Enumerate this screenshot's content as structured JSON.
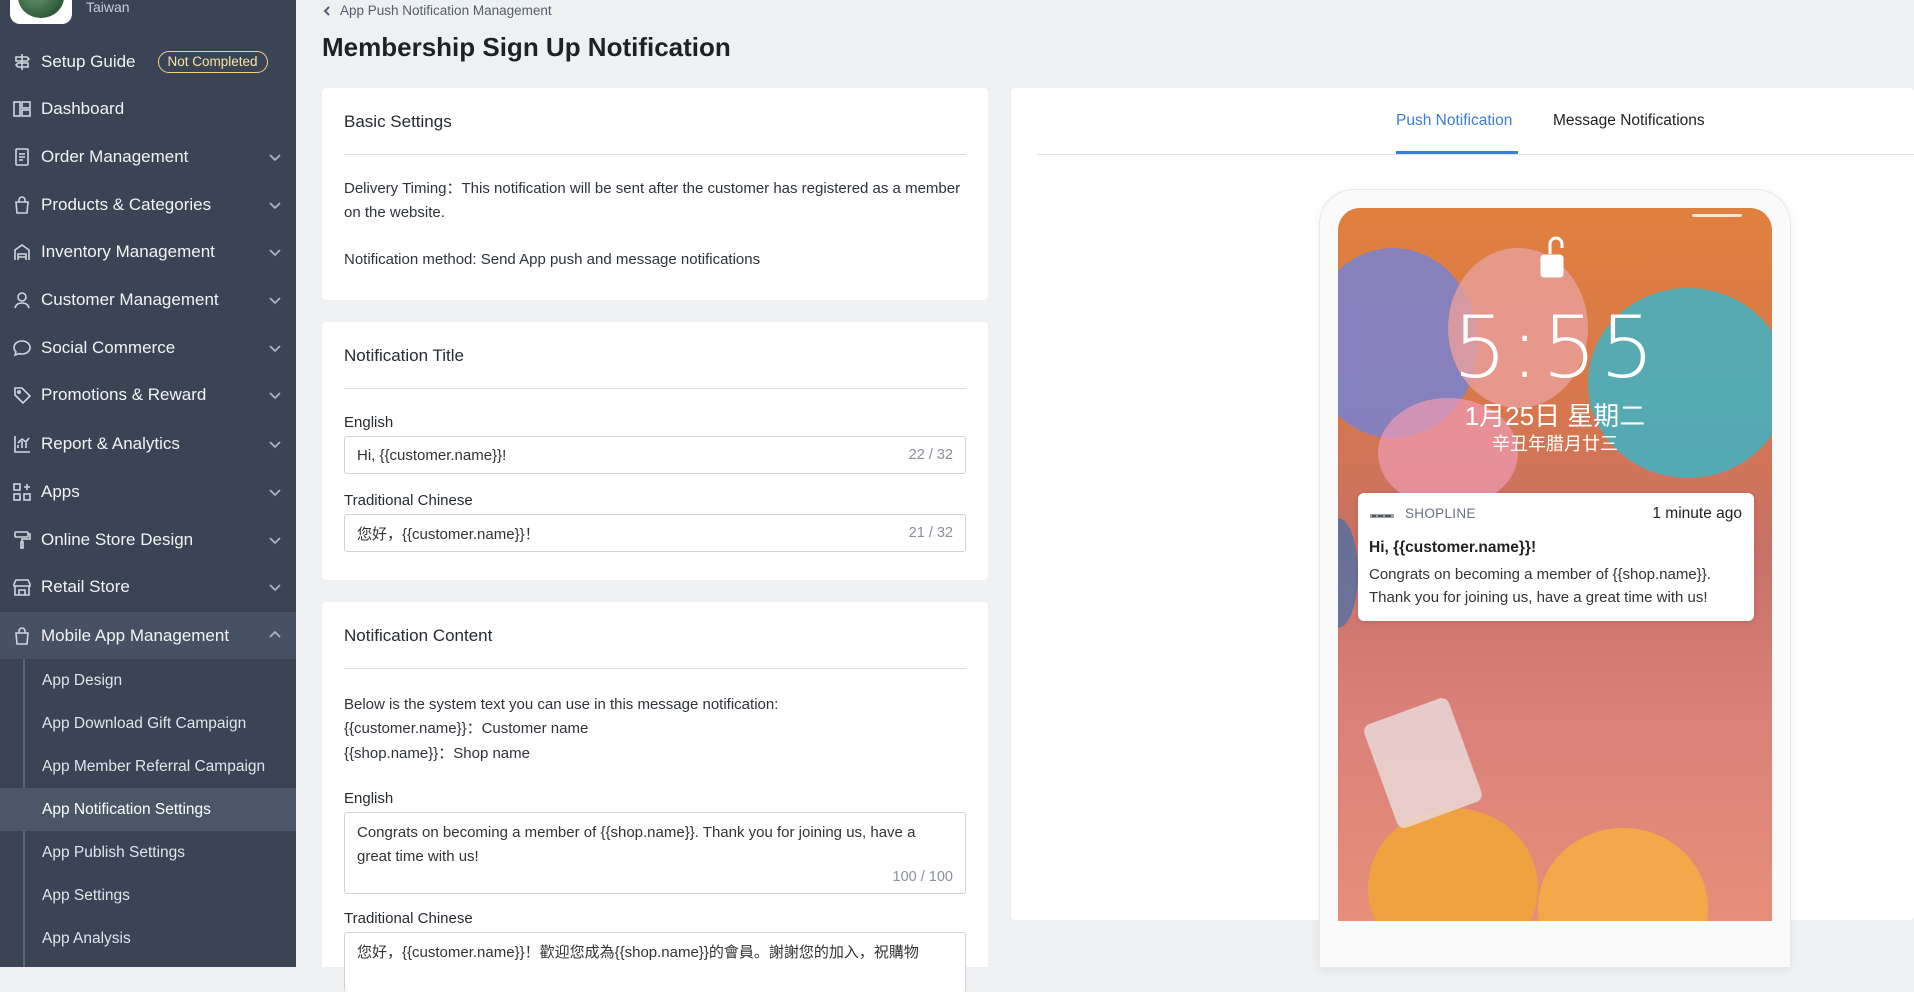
{
  "sidebar": {
    "store_country": "Taiwan",
    "items": [
      {
        "label": "Setup Guide",
        "icon": "signpost-icon",
        "badge": "Not Completed"
      },
      {
        "label": "Dashboard",
        "icon": "dashboard-icon"
      },
      {
        "label": "Order Management",
        "icon": "clipboard-icon"
      },
      {
        "label": "Products & Categories",
        "icon": "shopping-bag-icon"
      },
      {
        "label": "Inventory Management",
        "icon": "warehouse-icon"
      },
      {
        "label": "Customer Management",
        "icon": "user-icon"
      },
      {
        "label": "Social Commerce",
        "icon": "chat-bubble-icon"
      },
      {
        "label": "Promotions & Reward",
        "icon": "tag-icon"
      },
      {
        "label": "Report & Analytics",
        "icon": "bar-chart-icon"
      },
      {
        "label": "Apps",
        "icon": "apps-grid-icon"
      },
      {
        "label": "Online Store Design",
        "icon": "paint-roller-icon"
      },
      {
        "label": "Retail Store",
        "icon": "store-icon"
      },
      {
        "label": "Mobile App Management",
        "icon": "shopping-bag-icon"
      }
    ],
    "sub_items": [
      {
        "label": "App Design"
      },
      {
        "label": "App Download Gift Campaign"
      },
      {
        "label": "App Member Referral Campaign"
      },
      {
        "label": "App Notification Settings"
      },
      {
        "label": "App Publish Settings"
      },
      {
        "label": "App Settings"
      },
      {
        "label": "App Analysis"
      }
    ]
  },
  "header": {
    "breadcrumb": "App Push Notification Management",
    "title": "Membership Sign Up Notification"
  },
  "basic_settings": {
    "title": "Basic Settings",
    "delivery_timing": "Delivery Timing：This notification will be sent after the customer has registered as a member on the website.",
    "notification_method": "Notification method: Send App push and message notifications"
  },
  "notification_title": {
    "title": "Notification Title",
    "english_label": "English",
    "english_value": "Hi, {{customer.name}}!",
    "english_counter": "22 / 32",
    "chinese_label": "Traditional Chinese",
    "chinese_value": "您好，{{customer.name}}！",
    "chinese_counter": "21 / 32"
  },
  "notification_content": {
    "title": "Notification Content",
    "intro": "Below is the system text you can use in this message notification:",
    "var_customer": "{{customer.name}}：Customer name",
    "var_shop": "{{shop.name}}：Shop name",
    "english_label": "English",
    "english_value": "Congrats on becoming a member of {{shop.name}}. Thank you for joining us, have a great time with us!",
    "english_counter": "100 / 100",
    "chinese_label": "Traditional Chinese",
    "chinese_value": "您好，{{customer.name}}！歡迎您成為{{shop.name}}的會員。謝謝您的加入，祝購物"
  },
  "preview": {
    "tabs": [
      {
        "label": "Push Notification",
        "active": true
      },
      {
        "label": "Message Notifications",
        "active": false
      }
    ],
    "lock_time": "5:55",
    "lock_date": "1月25日 星期二",
    "lock_lunar": "辛丑年腊月廿三",
    "notif_app_name": "SHOPLINE",
    "notif_time": "1 minute ago",
    "notif_title": "Hi, {{customer.name}}!",
    "notif_body": "Congrats on becoming a member of {{shop.name}}. Thank you for joining us, have a great time with us!"
  },
  "colors": {
    "sidebar_bg": "#3a4454",
    "accent": "#3b7ddd",
    "badge_border": "#f1d27a"
  }
}
